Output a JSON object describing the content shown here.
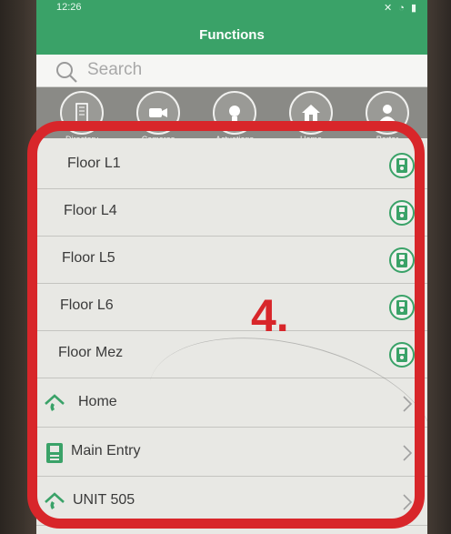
{
  "header": {
    "status_time": "12:26",
    "status_icons": "✕ ◔ ▮",
    "title": "Functions"
  },
  "search": {
    "placeholder": "Search"
  },
  "categories": [
    {
      "label": "Directory",
      "icon": "building-icon"
    },
    {
      "label": "Cameras",
      "icon": "camera-icon"
    },
    {
      "label": "Actuations",
      "icon": "lightbulb-icon"
    },
    {
      "label": "Home",
      "icon": "home-icon"
    },
    {
      "label": "Porter",
      "icon": "porter-icon"
    }
  ],
  "list": {
    "items": [
      {
        "label": "Floor L1",
        "type": "intercom"
      },
      {
        "label": "Floor L4",
        "type": "intercom"
      },
      {
        "label": "Floor L5",
        "type": "intercom"
      },
      {
        "label": "Floor L6",
        "type": "intercom"
      },
      {
        "label": "Floor Mez",
        "type": "intercom"
      },
      {
        "label": "Home",
        "type": "navigate",
        "icon": "home-phone-icon"
      },
      {
        "label": "Main Entry",
        "type": "navigate",
        "icon": "intercom-panel-icon"
      },
      {
        "label": "UNIT 505",
        "type": "navigate",
        "icon": "home-phone-icon"
      }
    ]
  },
  "annotation": {
    "number": "4.",
    "color": "#d8262a"
  },
  "colors": {
    "accent": "#3aa268",
    "annotation_red": "#d8262a"
  }
}
